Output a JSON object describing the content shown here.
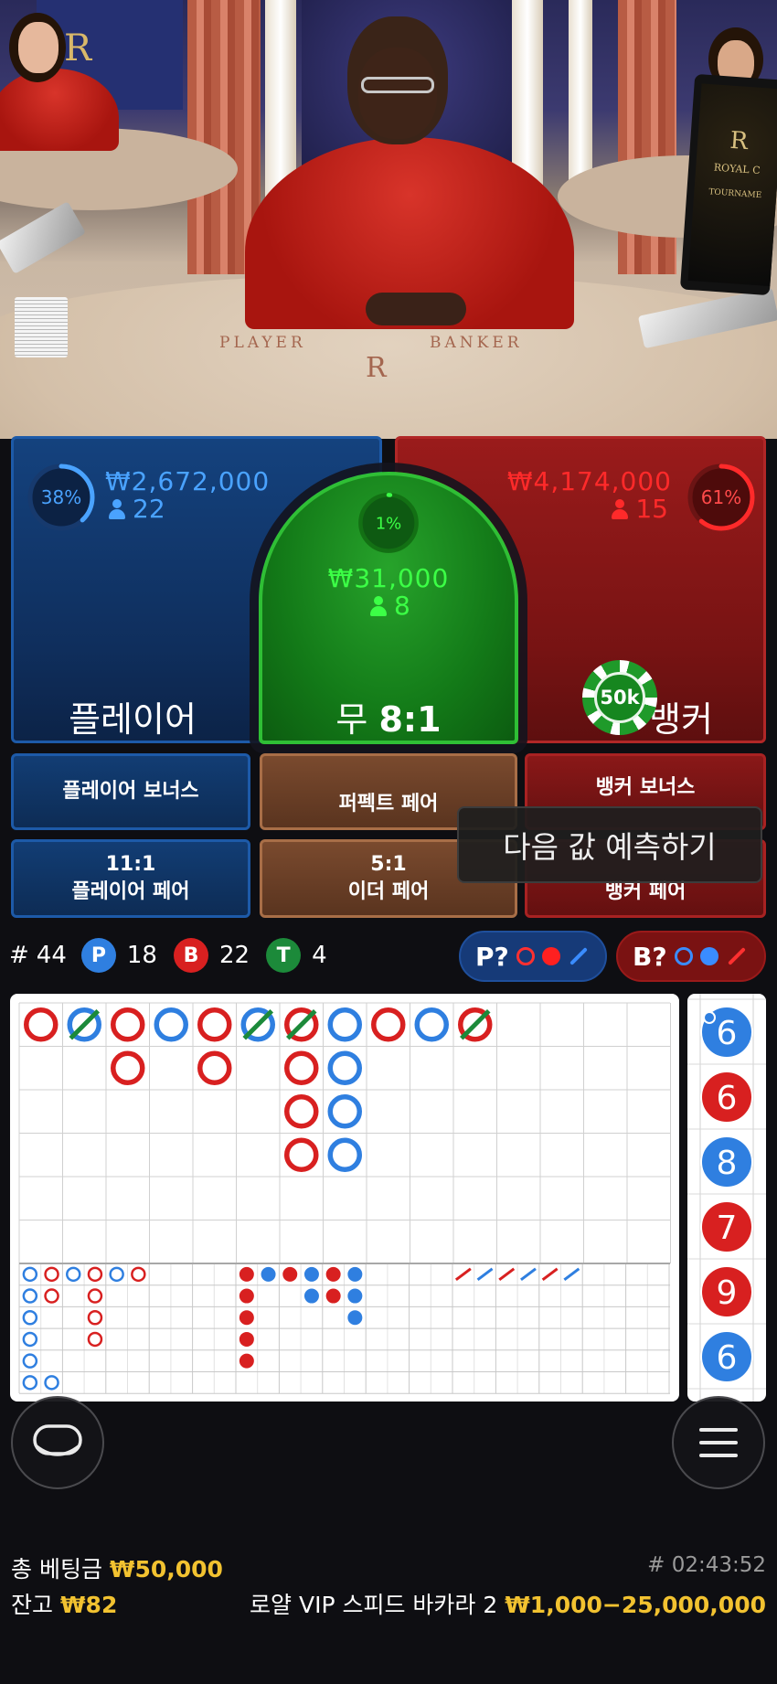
{
  "video": {
    "table_player_text": "PLAYER",
    "table_banker_text": "BANKER",
    "emblem_letter": "R",
    "monitor_title": "ROYAL C",
    "monitor_subtitle": "TOURNAME"
  },
  "player": {
    "percent_label": "38%",
    "percent_value": 38,
    "amount": "₩2,672,000",
    "count": "22",
    "label": "플레이어",
    "color": "#4aa3ff"
  },
  "tie": {
    "percent_label": "1%",
    "percent_value": 1,
    "amount": "₩31,000",
    "count": "8",
    "label_prefix": "무",
    "label_odds": "8:1",
    "color": "#3cff46"
  },
  "banker": {
    "percent_label": "61%",
    "percent_value": 61,
    "amount": "₩4,174,000",
    "count": "15",
    "label": "뱅커",
    "color": "#ff2a2a"
  },
  "chip": {
    "label": "50k"
  },
  "side_bets": {
    "player_bonus": "플레이어 보너스",
    "perfect_pair": "퍼펙트 페어",
    "banker_bonus": "뱅커 보너스",
    "player_pair_odds": "11:1",
    "player_pair": "플레이어 페어",
    "either_pair_odds": "5:1",
    "either_pair": "이더 페어",
    "banker_pair": "뱅커 페어"
  },
  "tooltip": {
    "text": "다음 값 예측하기"
  },
  "stats": {
    "round_prefix": "#",
    "round": "44",
    "p_label": "P",
    "p_count": "18",
    "b_label": "B",
    "b_count": "22",
    "t_label": "T",
    "t_count": "4"
  },
  "predict": {
    "player_label": "P?",
    "banker_label": "B?"
  },
  "colors": {
    "player_blue": "#2f7fe0",
    "banker_red": "#d82020",
    "tie_green": "#1c8a3a"
  },
  "bead_road_numbers": [
    "6",
    "6",
    "8",
    "7",
    "9",
    "6"
  ],
  "bead_road_colors": [
    "blue",
    "red",
    "blue",
    "red",
    "red",
    "blue"
  ],
  "footer": {
    "total_bet_label": "총 베팅금",
    "total_bet_value": "₩50,000",
    "game_id": "# 02:43:52",
    "balance_label": "잔고",
    "balance_value": "₩82",
    "table_name": "로얄 VIP 스피드 바카라 2",
    "limits": "₩1,000−25,000,000"
  },
  "icons": {
    "chat": "chat-icon",
    "menu": "menu-icon"
  }
}
